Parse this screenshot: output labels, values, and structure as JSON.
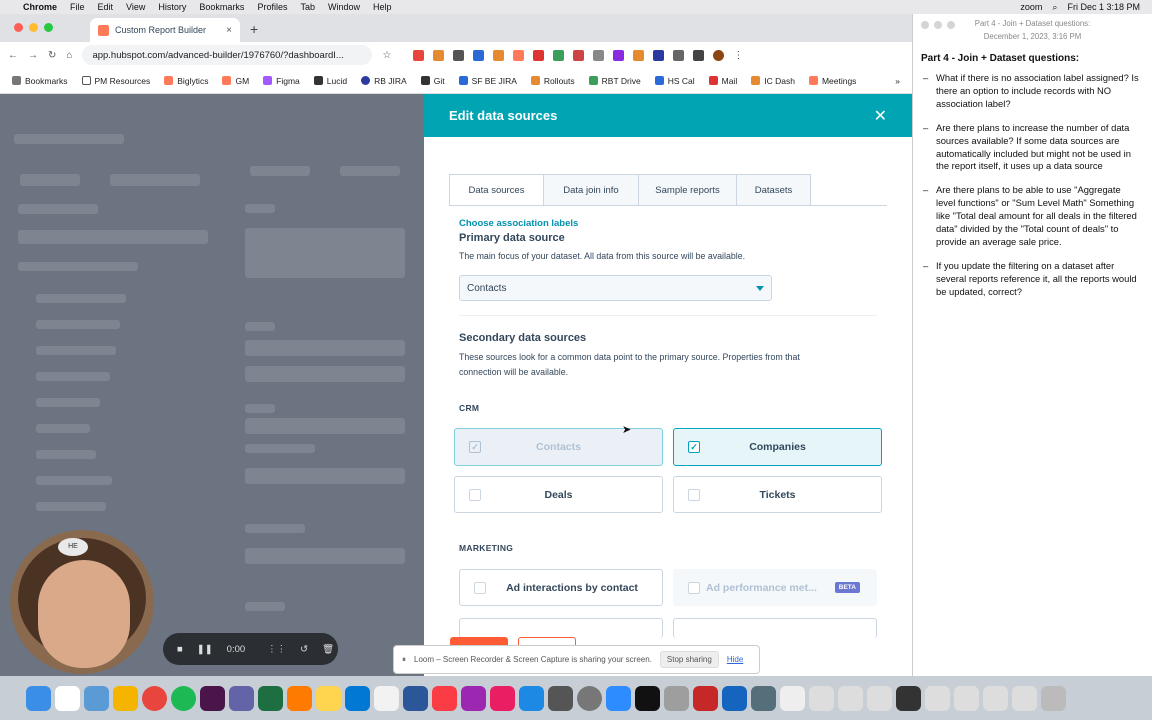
{
  "menubar": {
    "app": "Chrome",
    "items": [
      "File",
      "Edit",
      "View",
      "History",
      "Bookmarks",
      "Profiles",
      "Tab",
      "Window",
      "Help"
    ],
    "zoom": "zoom",
    "clock": "Fri Dec 1  3:18 PM"
  },
  "browser": {
    "tab_title": "Custom Report Builder",
    "url": "app.hubspot.com/advanced-builder/1976760/?dashboardI...",
    "bookmarks": [
      "Bookmarks",
      "PM Resources",
      "Biglytics",
      "GM",
      "Figma",
      "Lucid",
      "RB JIRA",
      "Git",
      "SF BE JIRA",
      "Rollouts",
      "RBT Drive",
      "HS Cal",
      "Mail",
      "IC Dash",
      "Meetings"
    ]
  },
  "panel": {
    "title": "Edit data sources",
    "tabs": [
      "Data sources",
      "Data join info",
      "Sample reports",
      "Datasets"
    ],
    "link": "Choose association labels",
    "primary_heading": "Primary data source",
    "primary_desc": "The main focus of your dataset. All data from this source will be available.",
    "primary_value": "Contacts",
    "secondary_heading": "Secondary data sources",
    "secondary_desc_1": "These sources look for a common data point to the primary source. Properties from that",
    "secondary_desc_2": "connection will be available.",
    "crm_label": "CRM",
    "crm_cards": [
      "Contacts",
      "Companies",
      "Deals",
      "Tickets"
    ],
    "marketing_label": "MARKETING",
    "marketing_cards": [
      "Ad interactions by contact",
      "Ad performance met..."
    ],
    "beta": "BETA"
  },
  "notes": {
    "window_title": "Part 4 - Join + Dataset questions:",
    "window_date": "December 1, 2023, 3:16 PM",
    "title": "Part 4 - Join + Dataset questions:",
    "items": [
      "What if there is no association label assigned? Is there an option to include records with NO association label?",
      "Are there plans to increase the number of data sources available? If some data sources are automatically included but might not be used in the report itself, it uses up a data source",
      "Are there plans to be able to use \"Aggregate level functions\" or \"Sum Level Math\" Something like \"Total deal amount for all deals in the filtered data\" divided by the \"Total count of deals\" to provide an average sale price.",
      "If you update the filtering on a dataset after several reports reference it, all the reports would be updated, correct?"
    ]
  },
  "recorder": {
    "time": "0:00"
  },
  "loom": {
    "message": "Loom – Screen Recorder & Screen Capture is sharing your screen.",
    "stop": "Stop sharing",
    "hide": "Hide"
  },
  "avatar": {
    "cap_text": "HE"
  }
}
